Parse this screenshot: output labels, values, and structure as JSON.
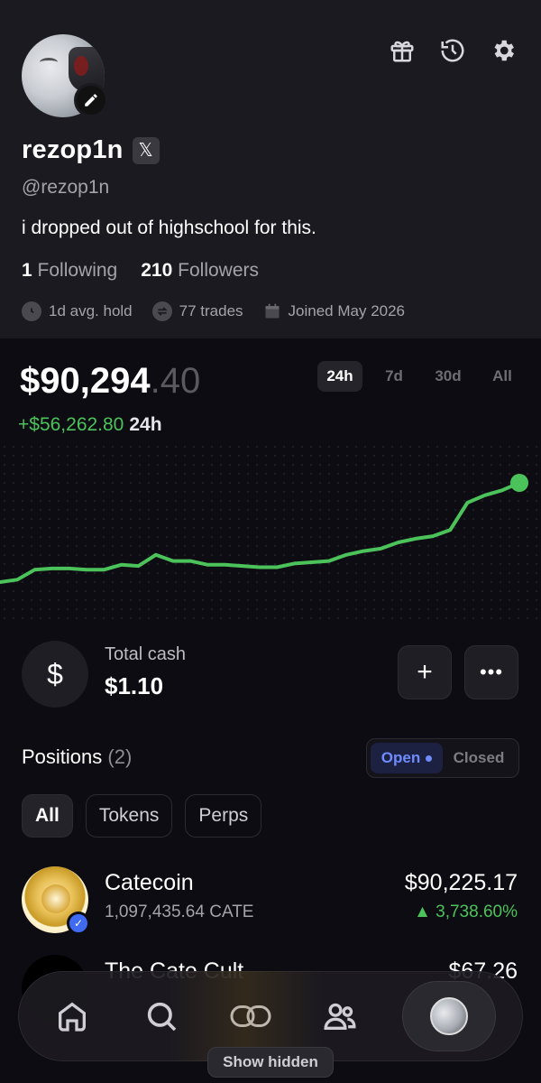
{
  "profile": {
    "username": "rezop1n",
    "x_badge": "𝕏",
    "handle": "@rezop1n",
    "bio": "i dropped out of highschool for this.",
    "following_count": "1",
    "following_label": "Following",
    "followers_count": "210",
    "followers_label": "Followers",
    "avg_hold": "1d avg. hold",
    "trades": "77 trades",
    "joined": "Joined May 2026"
  },
  "portfolio": {
    "balance_main": "$90,294",
    "balance_cents": ".40",
    "change_value": "+$56,262.80",
    "change_period": "24h",
    "ranges": [
      "24h",
      "7d",
      "30d",
      "All"
    ],
    "active_range": "24h"
  },
  "chart_data": {
    "type": "line",
    "x": [
      0,
      1,
      2,
      3,
      4,
      5,
      6,
      7,
      8,
      9,
      10,
      11,
      12,
      13,
      14,
      15,
      16,
      17,
      18,
      19,
      20,
      21,
      22,
      23,
      24,
      25,
      26,
      27,
      28,
      29,
      30
    ],
    "values": [
      0,
      2,
      10,
      11,
      11,
      10,
      10,
      14,
      13,
      22,
      17,
      17,
      14,
      14,
      13,
      12,
      12,
      15,
      16,
      17,
      22,
      25,
      27,
      32,
      35,
      37,
      42,
      64,
      70,
      74,
      80
    ],
    "color": "#4cc35a"
  },
  "cash": {
    "icon": "$",
    "label": "Total cash",
    "value": "$1.10",
    "add_label": "+",
    "more_label": "•••"
  },
  "positions": {
    "title": "Positions",
    "count": "(2)",
    "open_label": "Open",
    "closed_label": "Closed",
    "filters": [
      "All",
      "Tokens",
      "Perps"
    ],
    "items": [
      {
        "name": "Catecoin",
        "amount": "1,097,435.64 CATE",
        "value": "$90,225.17",
        "change": "▲ 3,738.60%"
      },
      {
        "name": "The Cate Cult",
        "amount": "",
        "value": "$67.26",
        "change": ""
      }
    ]
  },
  "nav": {
    "show_hidden": "Show hidden"
  }
}
